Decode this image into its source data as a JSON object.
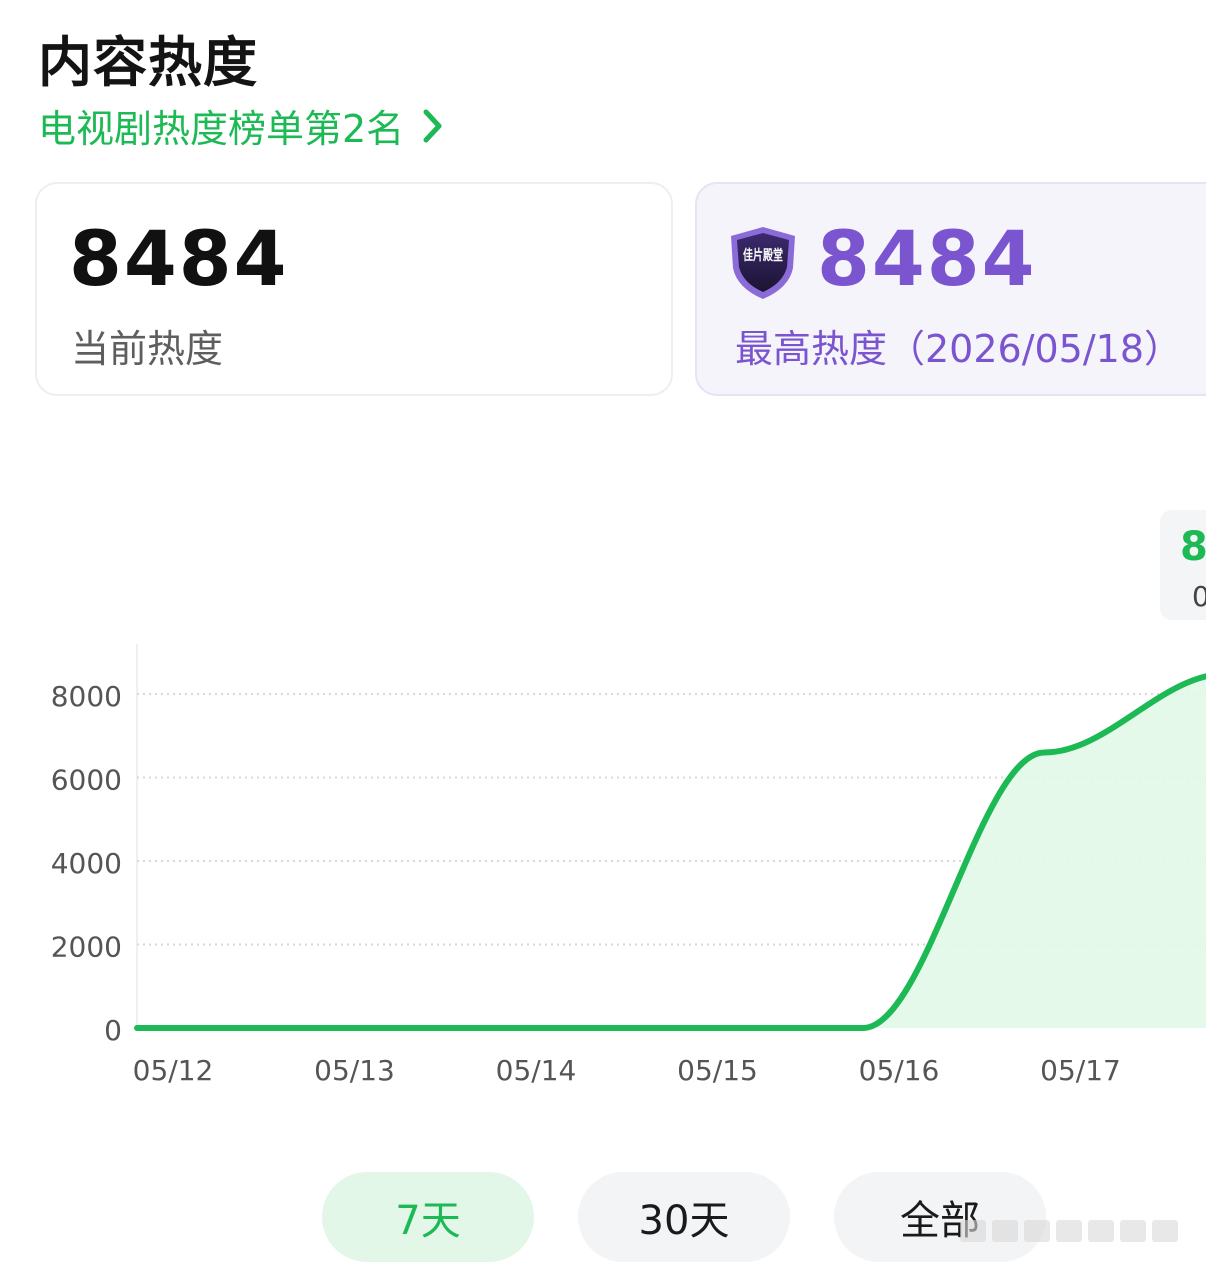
{
  "header": {
    "title": "内容热度",
    "rank_text": "电视剧热度榜单第2名"
  },
  "current": {
    "value": "8484",
    "label": "当前热度"
  },
  "peak": {
    "value": "8484",
    "label": "最高热度（2026/05/18）",
    "badge_text": "佳片殿堂"
  },
  "tooltip": {
    "value": "8",
    "date": "0"
  },
  "tabs": {
    "items": [
      "7天",
      "30天",
      "全部"
    ],
    "active_index": 0
  },
  "colors": {
    "accent_green": "#1db954",
    "peak_purple": "#7a55cf",
    "area_fill": "#e2f8e9"
  },
  "chart_data": {
    "type": "area",
    "x": [
      "05/12",
      "05/13",
      "05/14",
      "05/15",
      "05/16",
      "05/17",
      "05/18"
    ],
    "y": [
      0,
      0,
      0,
      0,
      0,
      6600,
      8484
    ],
    "ylim": [
      0,
      8000
    ],
    "yticks": [
      0,
      2000,
      4000,
      6000,
      8000
    ],
    "xtick_labels_visible": [
      "05/12",
      "05/13",
      "05/14",
      "05/15",
      "05/16",
      "05/17"
    ],
    "grid": true,
    "legend": "none"
  }
}
